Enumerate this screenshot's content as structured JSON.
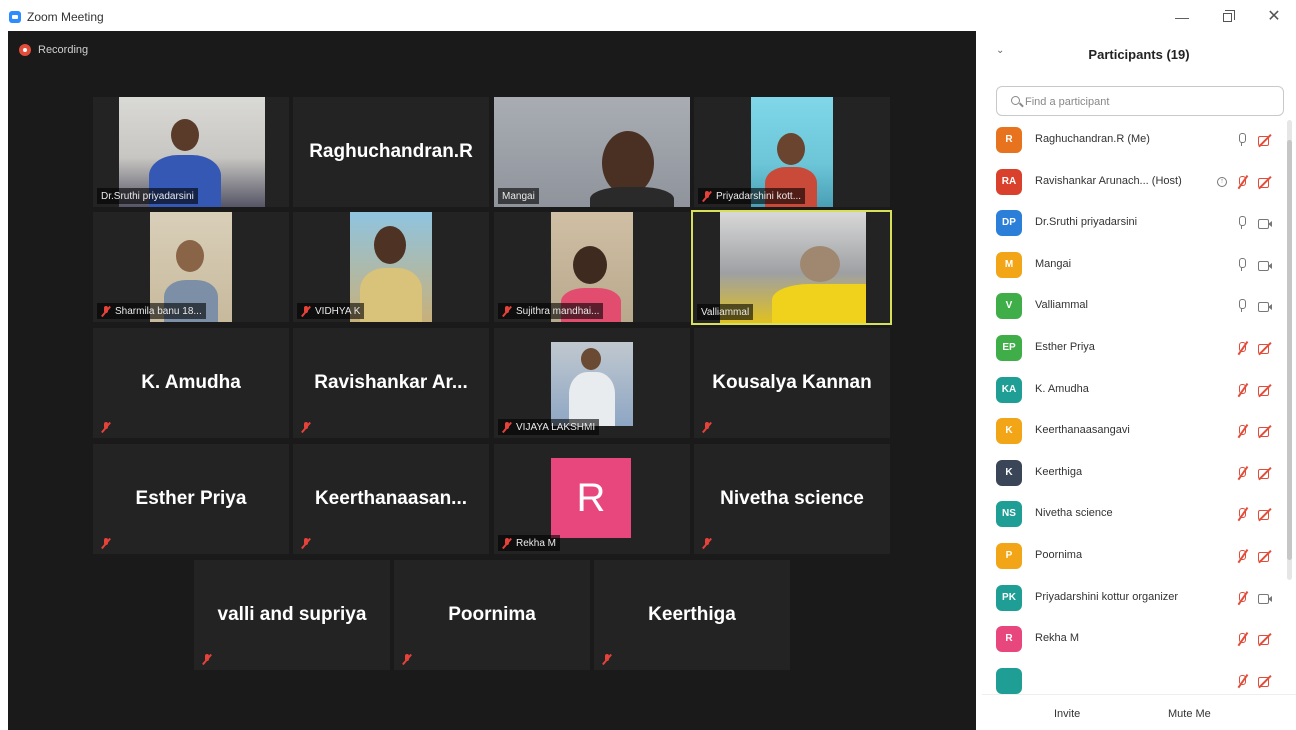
{
  "window": {
    "title": "Zoom Meeting",
    "minimize": "—",
    "close": "✕"
  },
  "recording": {
    "label": "Recording"
  },
  "tiles": {
    "sruthi": "Dr.Sruthi priyadarsini",
    "raghu": "Raghuchandran.R",
    "mangai": "Mangai",
    "priya": "Priyadarshini  kott...",
    "sharmila": "Sharmila banu 18...",
    "vidhya": "VIDHYA K",
    "sujithra": "Sujithra mandhai...",
    "valliammal": "Valliammal",
    "amudha": "K. Amudha",
    "ravishankar": "Ravishankar  Ar...",
    "vijaya": "VIJAYA LAKSHMI",
    "kousalya": "Kousalya Kannan",
    "esther": "Esther Priya",
    "keerthanaa": "Keerthanaasan...",
    "rekha": "Rekha M",
    "rekha_initial": "R",
    "nivetha": "Nivetha science",
    "valli_supriya": "valli and supriya",
    "poornima": "Poornima",
    "keerthiga": "Keerthiga"
  },
  "panel": {
    "title": "Participants (19)",
    "search_placeholder": "Find a participant",
    "invite_label": "Invite",
    "mute_me_label": "Mute Me",
    "participants": [
      {
        "initials": "R",
        "name": "Raghuchandran.R (Me)",
        "color": "#e8731e",
        "mic": "on",
        "video": "off"
      },
      {
        "initials": "RA",
        "name": "Ravishankar Arunach... (Host)",
        "color": "#d9412c",
        "mic": "off",
        "video": "off"
      },
      {
        "initials": "DP",
        "name": "Dr.Sruthi priyadarsini",
        "color": "#2b7fd9",
        "mic": "on",
        "video": "on"
      },
      {
        "initials": "M",
        "name": "Mangai",
        "color": "#f2a516",
        "mic": "on",
        "video": "on"
      },
      {
        "initials": "V",
        "name": "Valliammal",
        "color": "#3fae49",
        "mic": "on",
        "video": "on"
      },
      {
        "initials": "EP",
        "name": "Esther Priya",
        "color": "#3fae49",
        "mic": "off",
        "video": "off"
      },
      {
        "initials": "KA",
        "name": "K. Amudha",
        "color": "#1f9e96",
        "mic": "off",
        "video": "off"
      },
      {
        "initials": "K",
        "name": "Keerthanaasangavi",
        "color": "#f2a516",
        "mic": "off",
        "video": "off"
      },
      {
        "initials": "K",
        "name": "Keerthiga",
        "color": "#3a4557",
        "mic": "off",
        "video": "off"
      },
      {
        "initials": "NS",
        "name": "Nivetha science",
        "color": "#1f9e96",
        "mic": "off",
        "video": "off"
      },
      {
        "initials": "P",
        "name": "Poornima",
        "color": "#f2a516",
        "mic": "off",
        "video": "off"
      },
      {
        "initials": "PK",
        "name": "Priyadarshini  kottur organizer",
        "color": "#1f9e96",
        "mic": "off",
        "video": "on"
      },
      {
        "initials": "R",
        "name": "Rekha M",
        "color": "#e8477d",
        "mic": "off",
        "video": "off"
      },
      {
        "initials": "",
        "name": "",
        "color": "#1f9e96",
        "mic": "off",
        "video": "off"
      }
    ]
  },
  "colors": {
    "meeting_bg": "#1a1a1a",
    "tile_bg": "#232323",
    "active_speaker_border": "#d8e05a",
    "muted_red": "#e5423a"
  },
  "icons": {
    "app": "zoom-icon",
    "rec": "recording-icon",
    "mic_off": "mic-off-icon",
    "search": "search-icon"
  }
}
